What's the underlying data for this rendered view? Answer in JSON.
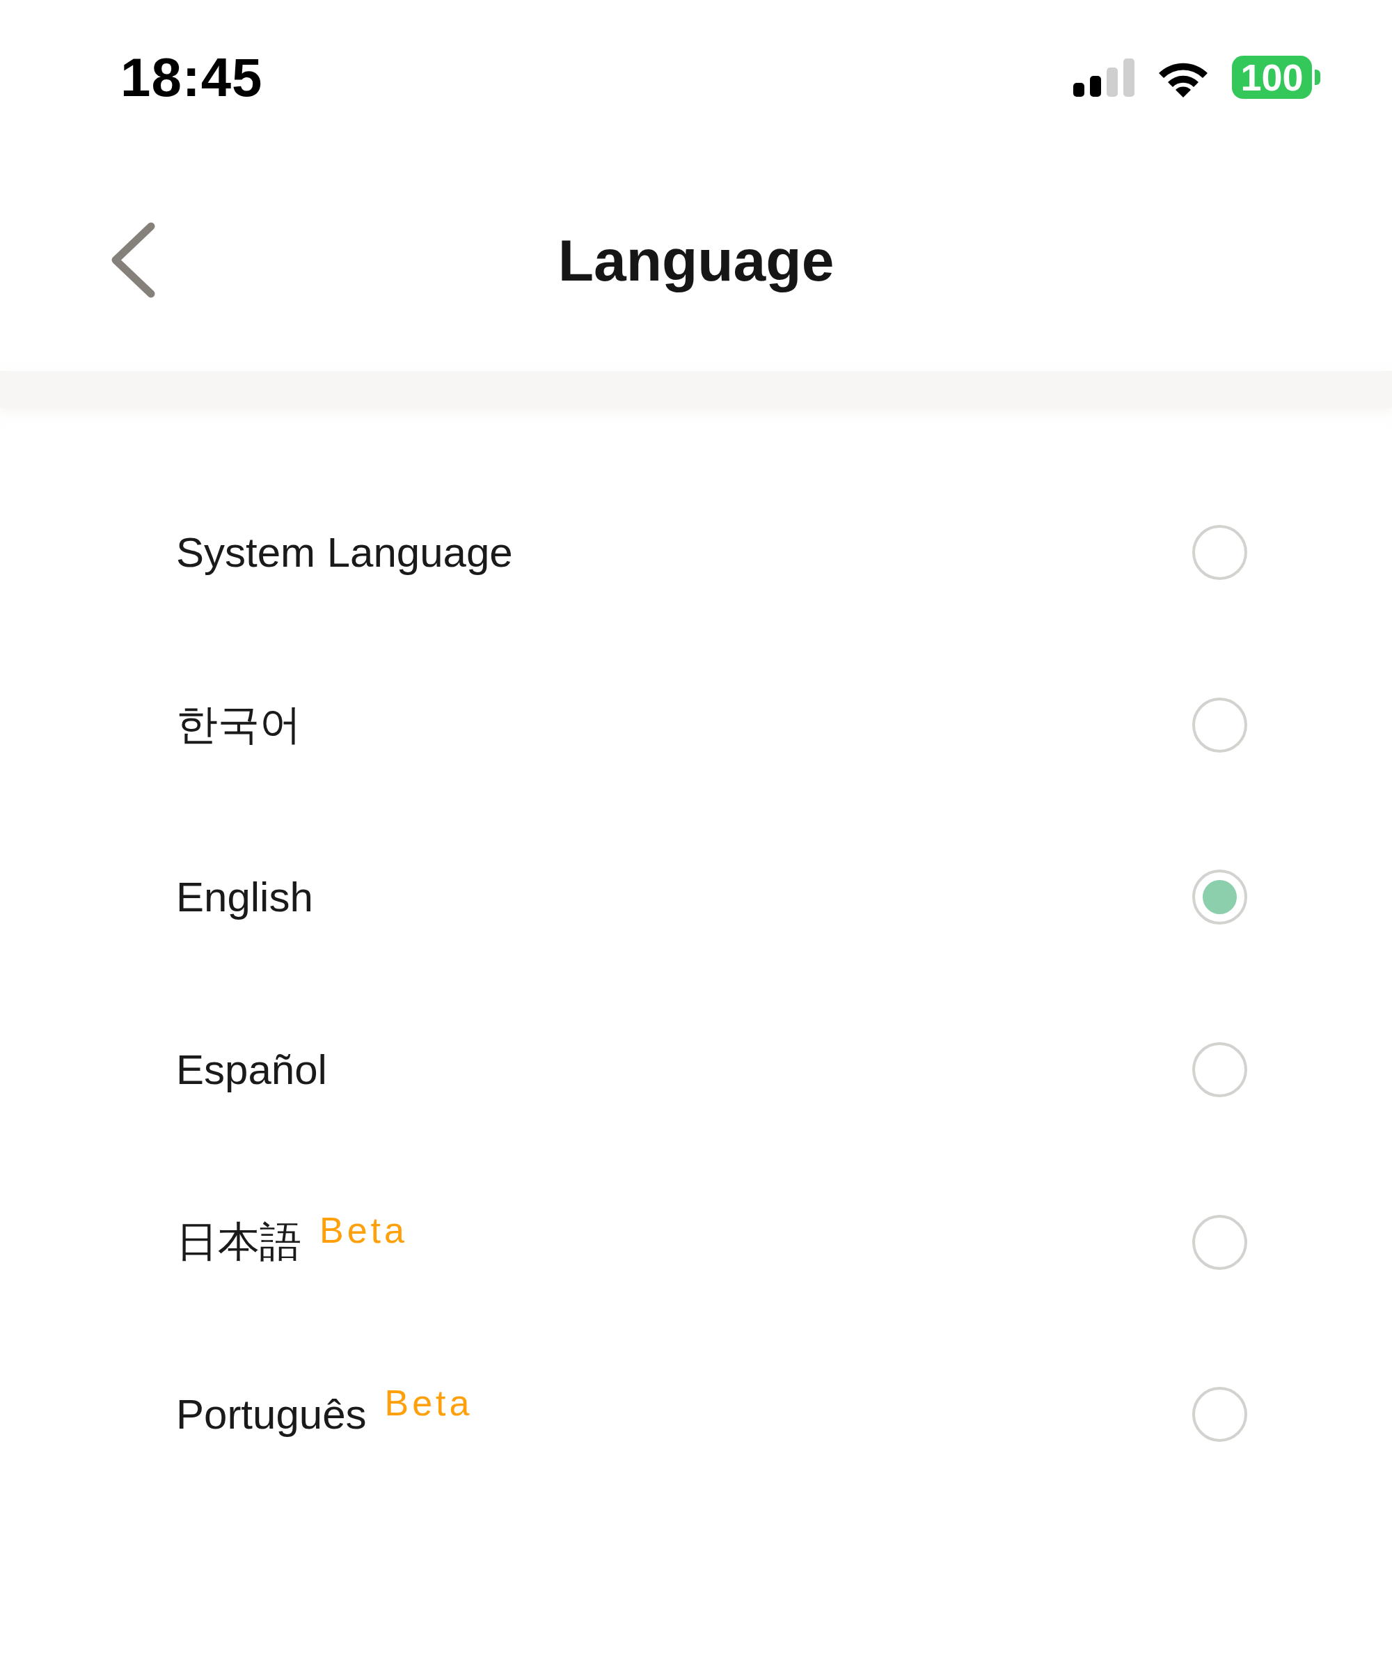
{
  "status_bar": {
    "time": "18:45",
    "battery": "100"
  },
  "header": {
    "title": "Language"
  },
  "languages": [
    {
      "label": "System Language",
      "selected": false
    },
    {
      "label": "한국어",
      "selected": false
    },
    {
      "label": "English",
      "selected": true
    },
    {
      "label": "Español",
      "selected": false
    },
    {
      "label": "日本語",
      "badge": "Beta",
      "selected": false
    },
    {
      "label": "Português",
      "badge": "Beta",
      "selected": false
    }
  ]
}
